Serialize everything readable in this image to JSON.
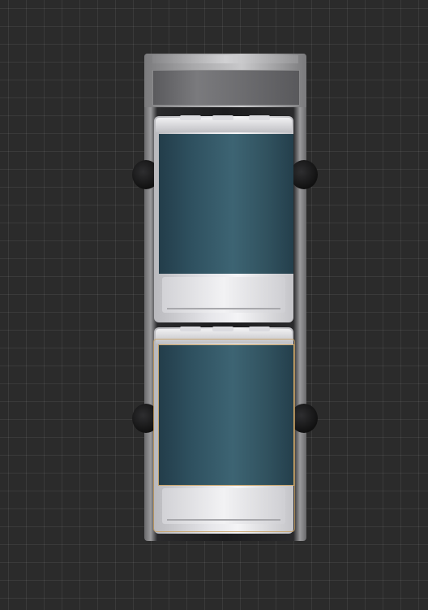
{
  "scene": {
    "background_color": "#2b2b2b",
    "grid": "on"
  },
  "truck": {
    "tank_color": "#2f5160",
    "modules": 2,
    "selected_module": 2
  }
}
